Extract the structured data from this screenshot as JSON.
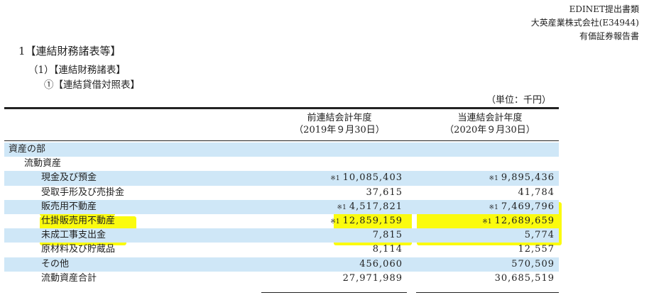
{
  "header": {
    "line1": "EDINET提出書類",
    "line2": "大英産業株式会社(E34944)",
    "line3": "有価証券報告書"
  },
  "heading1": "1【連結財務諸表等】",
  "heading2": "（1）【連結財務諸表】",
  "heading3": "①【連結貸借対照表】",
  "unit": "（単位：千円）",
  "columns": {
    "prev": {
      "line1": "前連結会計年度",
      "line2": "（2019年９月30日）"
    },
    "curr": {
      "line1": "当連結会計年度",
      "line2": "（2020年９月30日）"
    }
  },
  "rows": [
    {
      "label": "資産の部",
      "prev_note": "",
      "prev": "",
      "curr_note": "",
      "curr": ""
    },
    {
      "label": "流動資産",
      "prev_note": "",
      "prev": "",
      "curr_note": "",
      "curr": ""
    },
    {
      "label": "現金及び預金",
      "prev_note": "※1",
      "prev": "10,085,403",
      "curr_note": "※1",
      "curr": "9,895,436"
    },
    {
      "label": "受取手形及び売掛金",
      "prev_note": "",
      "prev": "37,615",
      "curr_note": "",
      "curr": "41,784"
    },
    {
      "label": "販売用不動産",
      "prev_note": "※1",
      "prev": "4,517,821",
      "curr_note": "※1",
      "curr": "7,469,796"
    },
    {
      "label": "仕掛販売用不動産",
      "prev_note": "※1",
      "prev": "12,859,159",
      "curr_note": "※1",
      "curr": "12,689,659"
    },
    {
      "label": "未成工事支出金",
      "prev_note": "",
      "prev": "7,815",
      "curr_note": "",
      "curr": "5,774"
    },
    {
      "label": "原材料及び貯蔵品",
      "prev_note": "",
      "prev": "8,114",
      "curr_note": "",
      "curr": "12,557"
    },
    {
      "label": "その他",
      "prev_note": "",
      "prev": "456,060",
      "curr_note": "",
      "curr": "570,509"
    },
    {
      "label": "流動資産合計",
      "prev_note": "",
      "prev": "27,971,989",
      "curr_note": "",
      "curr": "30,685,519"
    }
  ],
  "colors": {
    "row_stripe": "#cfe7f7",
    "highlight": "#fbfb0e"
  }
}
